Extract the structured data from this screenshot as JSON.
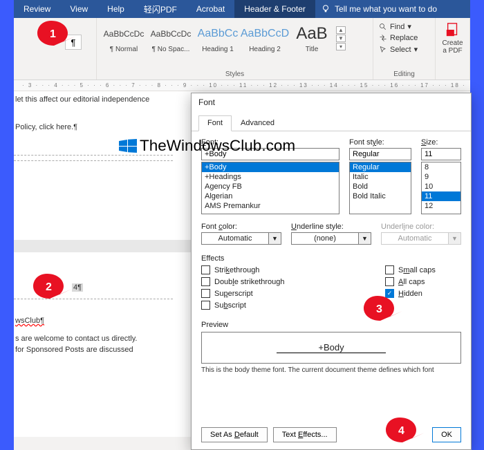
{
  "ribbon": {
    "tabs": [
      "Review",
      "View",
      "Help",
      "轻闪PDF",
      "Acrobat",
      "Header & Footer"
    ],
    "tellme": "Tell me what you want to do"
  },
  "styles": {
    "label": "Styles",
    "tiles": [
      {
        "preview": "AaBbCcDc",
        "name": "¶ Normal"
      },
      {
        "preview": "AaBbCcDc",
        "name": "¶ No Spac..."
      },
      {
        "preview": "AaBbCc",
        "name": "Heading 1"
      },
      {
        "preview": "AaBbCcD",
        "name": "Heading 2"
      },
      {
        "preview": "AaB",
        "name": "Title"
      }
    ]
  },
  "editing": {
    "label": "Editing",
    "find": "Find",
    "replace": "Replace",
    "select": "Select"
  },
  "adobe": {
    "create": "Create",
    "pdf": "a PDF"
  },
  "ruler": "· 3 · · · 4 · · · 5 · · · 6 · · · 7 · · · 8 · · · 9 · · · 10 · · · 11 · · · 12 · · · 13 · · · 14 · · · 15 · · · 16 · · · 17 · · · 18 ·",
  "doc": {
    "line1": "let this affect our editorial independence",
    "line2": "Policy, click here.¶",
    "line3": "4¶",
    "line4": "wsClub¶",
    "line5": "s are welcome to contact us directly.",
    "line6": "for Sponsored Posts are discussed"
  },
  "dialog": {
    "title": "Font",
    "tabs": {
      "font": "Font",
      "advanced": "Advanced"
    },
    "font_label": "Font:",
    "font_value": "+Body",
    "font_list": [
      "+Body",
      "+Headings",
      "Agency FB",
      "Algerian",
      "AMS Premankur"
    ],
    "style_label": "Font style:",
    "style_value": "Regular",
    "style_list": [
      "Regular",
      "Italic",
      "Bold",
      "Bold Italic"
    ],
    "size_label": "Size:",
    "size_value": "11",
    "size_list": [
      "8",
      "9",
      "10",
      "11",
      "12"
    ],
    "color_label": "Font color:",
    "color_value": "Automatic",
    "ustyle_label": "Underline style:",
    "ustyle_value": "(none)",
    "ucolor_label": "Underline color:",
    "ucolor_value": "Automatic",
    "effects_label": "Effects",
    "strike": "Strikethrough",
    "dblstrike": "Double strikethrough",
    "supers": "Superscript",
    "subs": "Subscript",
    "smallcaps": "Small caps",
    "allcaps": "All caps",
    "hidden": "Hidden",
    "preview_label": "Preview",
    "preview_text": "+Body",
    "preview_desc": "This is the body theme font. The current document theme defines which font",
    "setdefault": "Set As Default",
    "texteffects": "Text Effects...",
    "ok": "OK"
  },
  "watermark": "TheWindowsClub.com",
  "callouts": {
    "c1": "1",
    "c2": "2",
    "c3": "3",
    "c4": "4"
  }
}
